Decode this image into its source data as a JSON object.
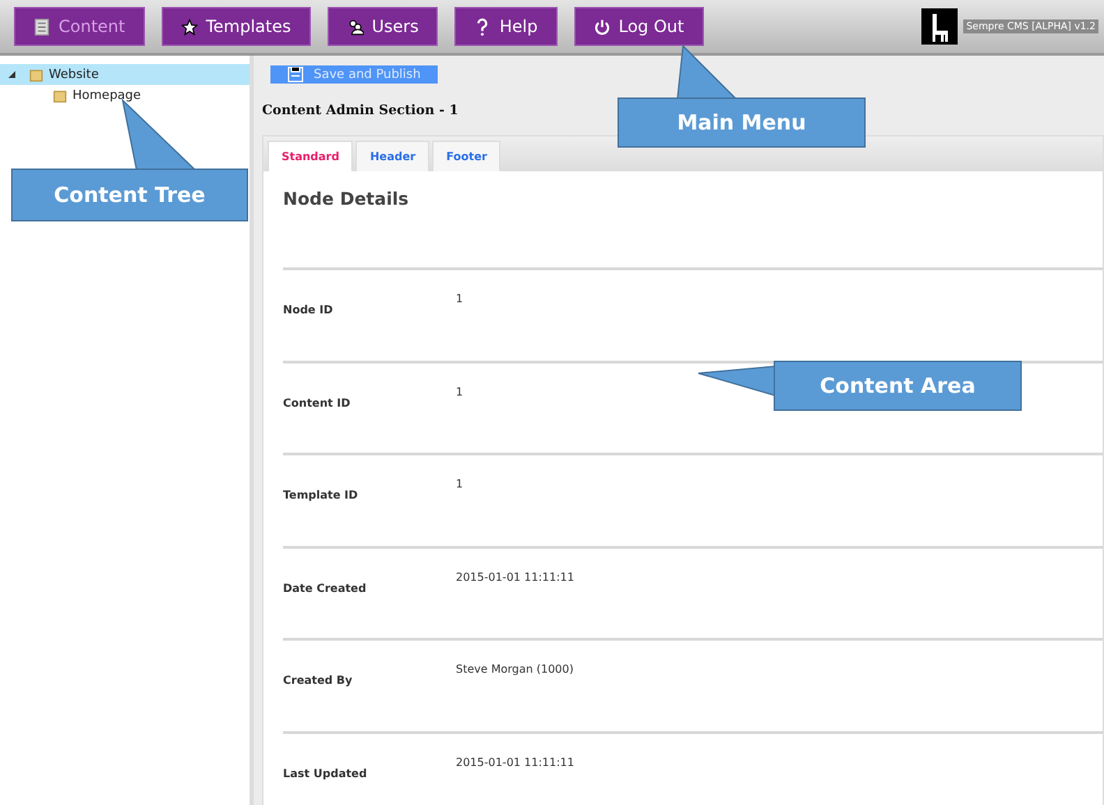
{
  "menu": [
    {
      "label": "Content",
      "selected": true
    },
    {
      "label": "Templates",
      "selected": false
    },
    {
      "label": "Users",
      "selected": false
    },
    {
      "label": "Help",
      "selected": false
    },
    {
      "label": "Log Out",
      "selected": false
    }
  ],
  "brand": {
    "name": "Sempre CMS [ALPHA] v1.2"
  },
  "tree": [
    {
      "label": "Website",
      "expanded": true,
      "selected": true,
      "children": [
        {
          "label": "Homepage",
          "selected": false
        }
      ]
    }
  ],
  "save_button": "Save and Publish",
  "section_title": "Content Admin Section - 1",
  "tabs": [
    {
      "label": "Standard",
      "selected": true
    },
    {
      "label": "Header",
      "selected": false
    },
    {
      "label": "Footer",
      "selected": false
    }
  ],
  "panel_heading": "Node Details",
  "fields": [
    {
      "label": "Node ID",
      "value": "1"
    },
    {
      "label": "Content ID",
      "value": "1"
    },
    {
      "label": "Template ID",
      "value": "1"
    },
    {
      "label": "Date Created",
      "value": "2015-01-01 11:11:11"
    },
    {
      "label": "Created By",
      "value": "Steve Morgan (1000)"
    },
    {
      "label": "Last Updated",
      "value": "2015-01-01 11:11:11"
    }
  ],
  "callouts": [
    {
      "text": "Main Menu"
    },
    {
      "text": "Content Tree"
    },
    {
      "text": "Content Area"
    }
  ]
}
